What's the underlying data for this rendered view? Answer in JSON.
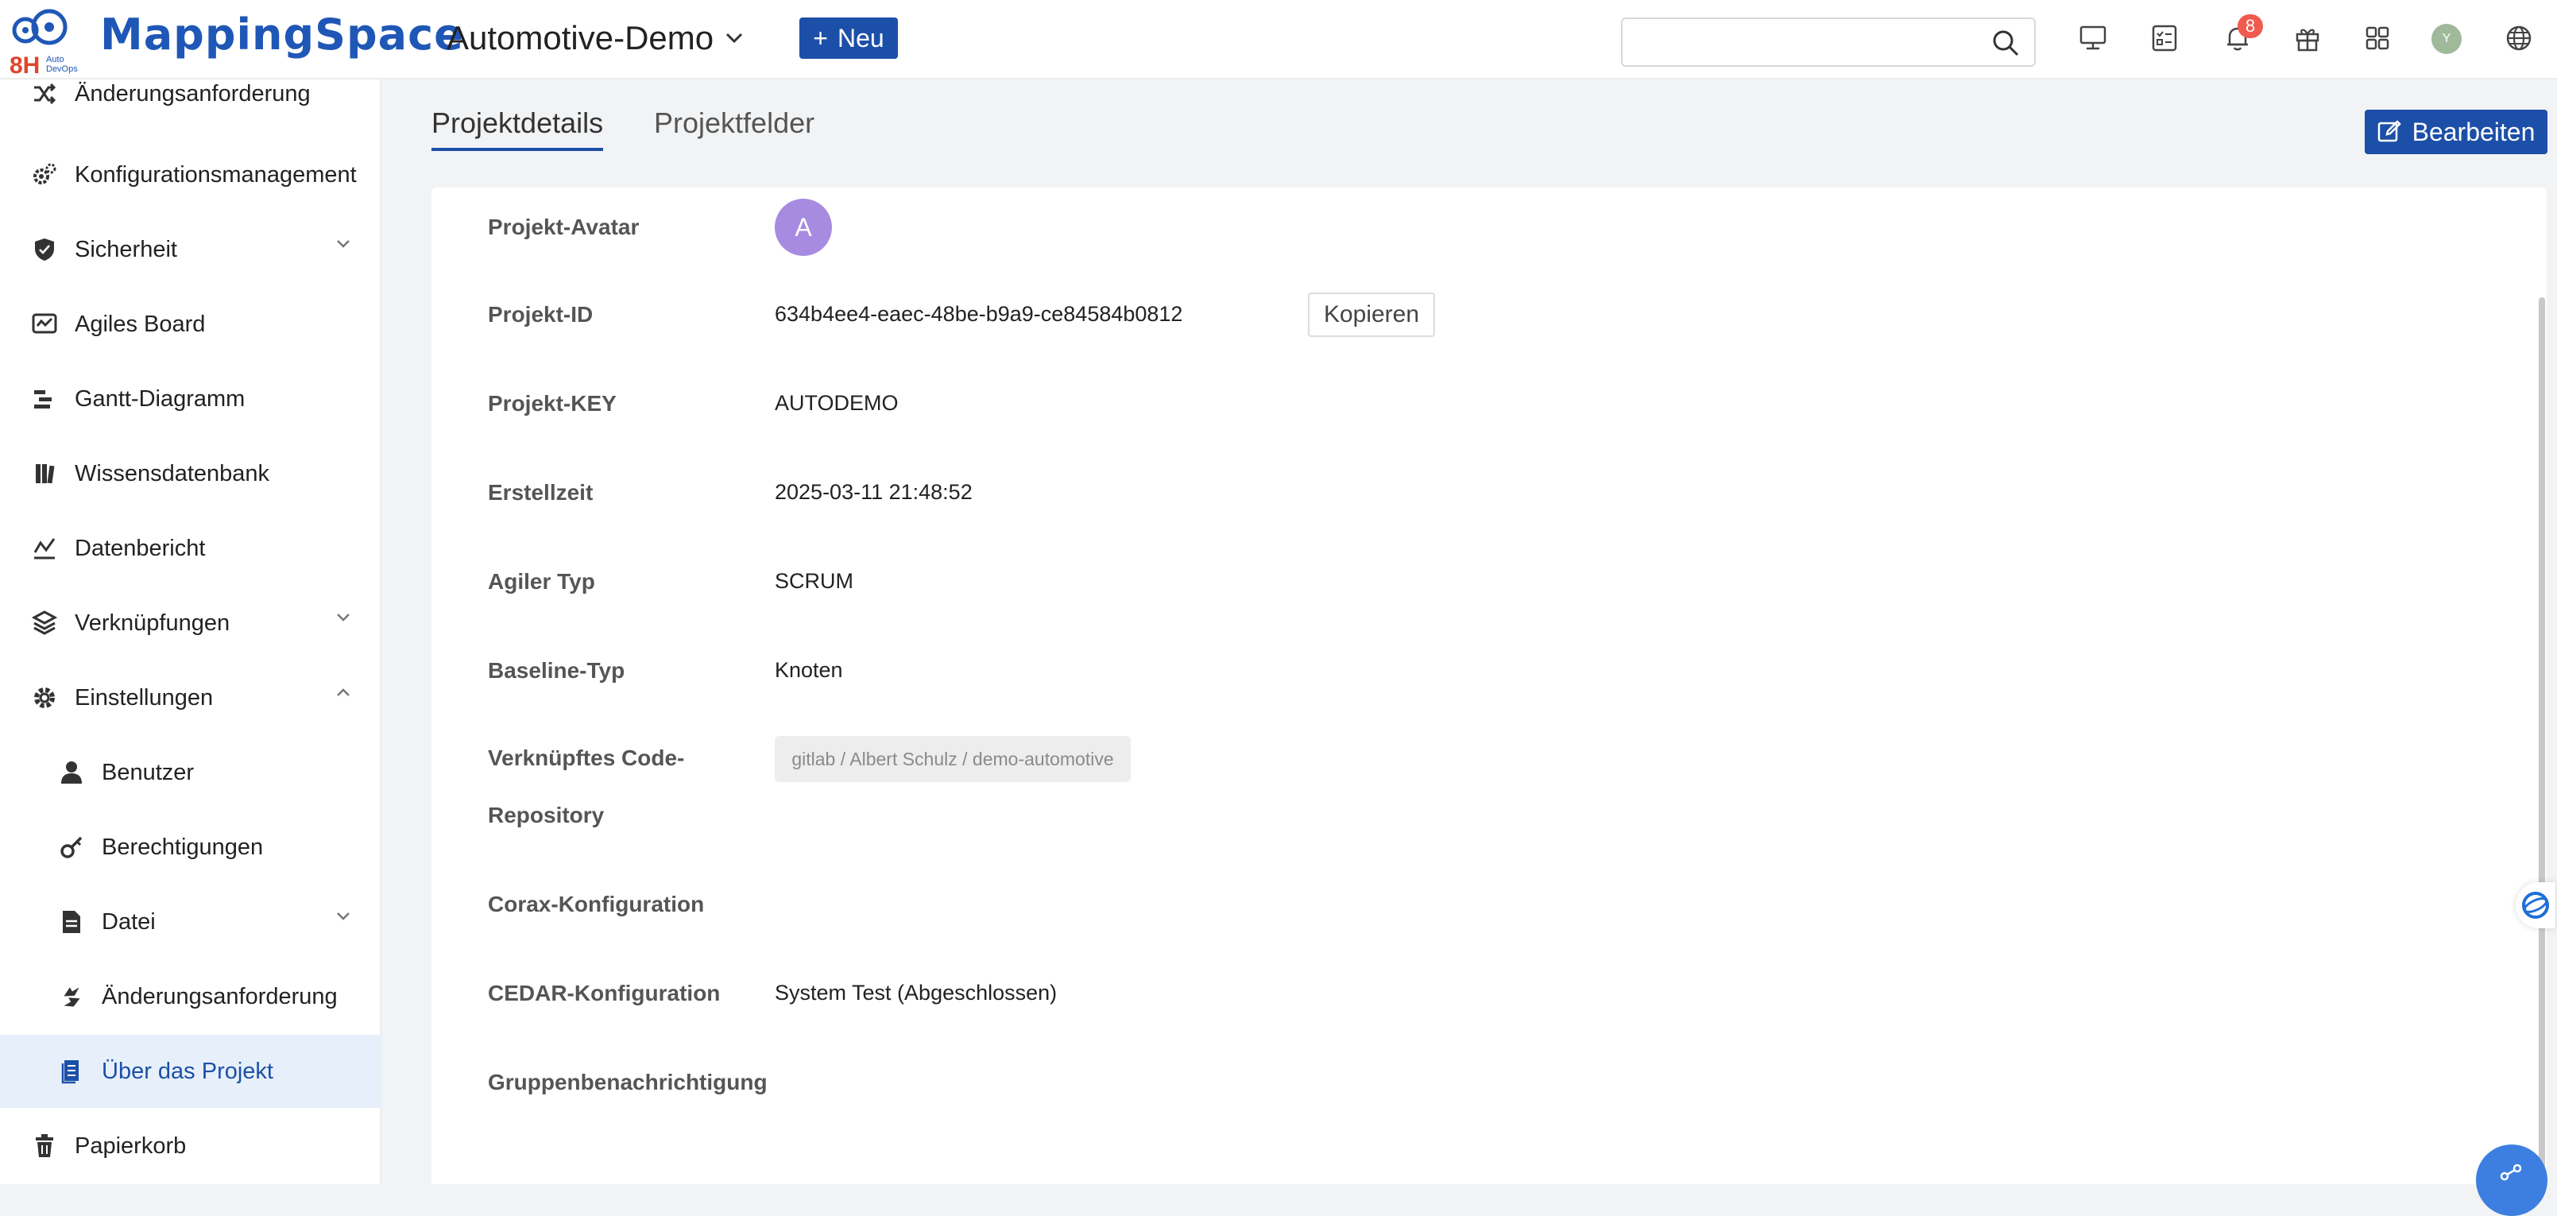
{
  "brand": {
    "logo_badge": "8H",
    "logo_sub_1": "Auto",
    "logo_sub_2": "DevOps",
    "name": "MappingSpace",
    "logo_color": "#1f57b6",
    "logo_accent": "#e0442b"
  },
  "header": {
    "project_name": "Automotive-Demo",
    "new_label": "Neu",
    "search_placeholder": "",
    "notification_count": "8",
    "user_initial": "Y",
    "icons": [
      "monitor-icon",
      "checklist-icon",
      "bell-icon",
      "gift-icon",
      "apps-grid-icon",
      "user-avatar",
      "globe-icon"
    ]
  },
  "sidebar": {
    "items": [
      {
        "label": "Änderungsanforderung",
        "icon": "shuffle-icon",
        "level": 1,
        "chevron": ""
      },
      {
        "label": "Konfigurationsmanagement",
        "icon": "gear-cluster-icon",
        "level": 1,
        "chevron": ""
      },
      {
        "label": "Sicherheit",
        "icon": "shield-icon",
        "level": 1,
        "chevron": "down"
      },
      {
        "label": "Agiles Board",
        "icon": "board-icon",
        "level": 1,
        "chevron": ""
      },
      {
        "label": "Gantt-Diagramm",
        "icon": "gantt-icon",
        "level": 1,
        "chevron": ""
      },
      {
        "label": "Wissensdatenbank",
        "icon": "book-icon",
        "level": 1,
        "chevron": ""
      },
      {
        "label": "Datenbericht",
        "icon": "chart-line-icon",
        "level": 1,
        "chevron": ""
      },
      {
        "label": "Verknüpfungen",
        "icon": "link-stack-icon",
        "level": 1,
        "chevron": "down"
      },
      {
        "label": "Einstellungen",
        "icon": "settings-icon",
        "level": 1,
        "chevron": "up"
      },
      {
        "label": "Benutzer",
        "icon": "user-icon",
        "level": 2,
        "chevron": ""
      },
      {
        "label": "Berechtigungen",
        "icon": "key-icon",
        "level": 2,
        "chevron": ""
      },
      {
        "label": "Datei",
        "icon": "file-icon",
        "level": 2,
        "chevron": "down"
      },
      {
        "label": "Änderungsanforderung",
        "icon": "swap-icon",
        "level": 2,
        "chevron": ""
      },
      {
        "label": "Über das Projekt",
        "icon": "document-icon",
        "level": 2,
        "chevron": "",
        "active": true
      },
      {
        "label": "Papierkorb",
        "icon": "trash-icon",
        "level": 1,
        "chevron": ""
      }
    ],
    "active_color": "#1c4fa8",
    "active_bg": "#e7f0fa"
  },
  "main": {
    "tabs": [
      {
        "label": "Projektdetails",
        "active": true
      },
      {
        "label": "Projektfelder",
        "active": false
      }
    ],
    "edit_label": "Bearbeiten",
    "copy_label": "Kopieren",
    "fields": [
      {
        "label": "Projekt-Avatar",
        "value": "A"
      },
      {
        "label": "Projekt-ID",
        "value": "634b4ee4-eaec-48be-b9a9-ce84584b0812"
      },
      {
        "label": "Projekt-KEY",
        "value": "AUTODEMO"
      },
      {
        "label": "Erstellzeit",
        "value": "2025-03-11 21:48:52"
      },
      {
        "label": "Agiler Typ",
        "value": "SCRUM"
      },
      {
        "label": "Baseline-Typ",
        "value": "Knoten"
      },
      {
        "label_line1": "Verknüpftes Code-",
        "label_line2": "Repository",
        "value": "gitlab / Albert Schulz / demo-automotive"
      },
      {
        "label": "Corax-Konfiguration",
        "value": ""
      },
      {
        "label": "CEDAR-Konfiguration",
        "value": "System Test (Abgeschlossen)"
      },
      {
        "label": "Gruppenbenachrichtigung",
        "value": ""
      }
    ],
    "avatar_color": "#a78be0"
  }
}
